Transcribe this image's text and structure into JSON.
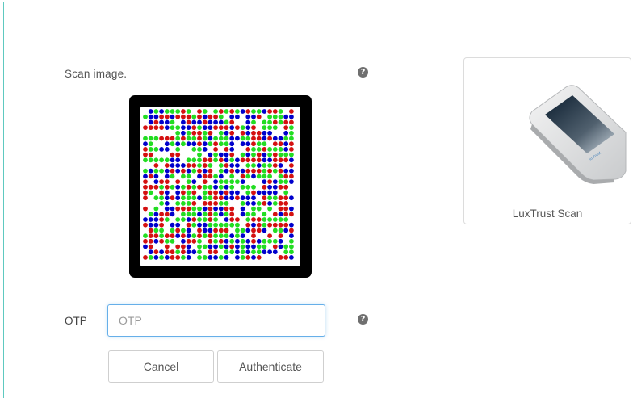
{
  "scan": {
    "label": "Scan image.",
    "help_icon": "question-circle-icon",
    "code_colors": [
      "#0000cc",
      "#d41111",
      "#22dd22"
    ]
  },
  "device": {
    "caption": "LuxTrust Scan",
    "image": "luxtrust-scan-device"
  },
  "otp": {
    "label": "OTP",
    "placeholder": "OTP",
    "value": "",
    "help_icon": "question-circle-icon"
  },
  "actions": {
    "cancel_label": "Cancel",
    "authenticate_label": "Authenticate"
  },
  "colors": {
    "frame_border": "#5ec9c0",
    "input_focus": "#66afe9"
  }
}
